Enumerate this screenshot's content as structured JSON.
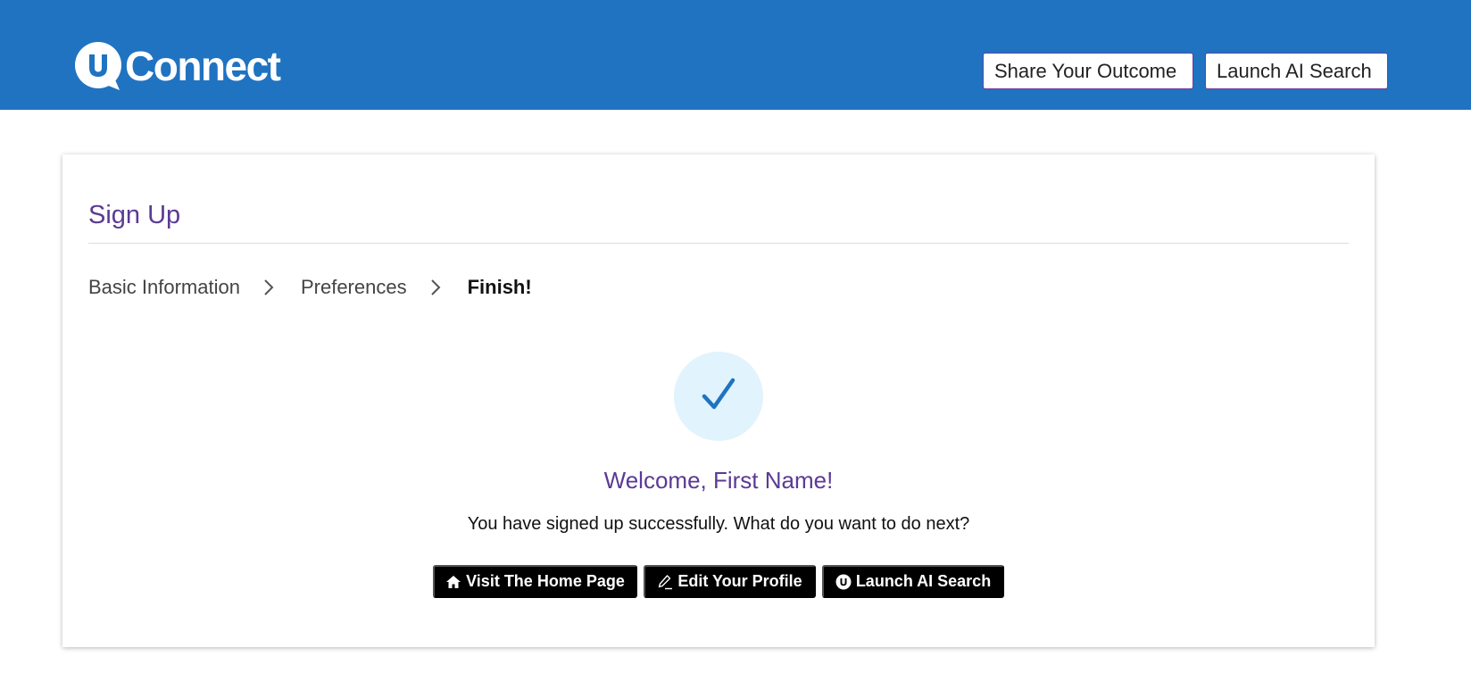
{
  "header": {
    "logo_text": "Connect",
    "logo_letter": "u",
    "buttons": {
      "share_label": "Share Your Outcome",
      "launch_label": "Launch AI Search"
    },
    "background_color": "#1f73c1"
  },
  "signup": {
    "title": "Sign Up",
    "steps": [
      {
        "label": "Basic Information",
        "active": false
      },
      {
        "label": "Preferences",
        "active": false
      },
      {
        "label": "Finish!",
        "active": true
      }
    ],
    "welcome": "Welcome, First Name!",
    "message": "You have signed up successfully. What do you want to do next?",
    "actions": {
      "home_label": "Visit The Home Page",
      "edit_label": "Edit Your Profile",
      "ai_label": "Launch AI Search"
    },
    "icons": {
      "status": "check-icon",
      "home": "home-icon",
      "edit": "pencil-icon",
      "ai": "uconnect-logo-icon"
    }
  },
  "colors": {
    "accent_purple": "#5b3a95",
    "check_blue": "#1f73c1",
    "check_bg": "#e1f3fc",
    "button_black": "#000000"
  }
}
